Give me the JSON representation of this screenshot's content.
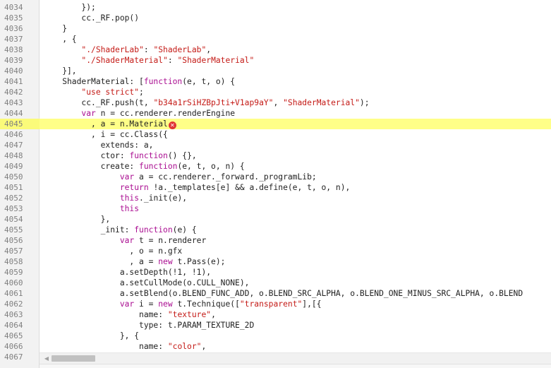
{
  "editor": {
    "highlight_line": "4045",
    "error_icon": "error-x-icon",
    "colors": {
      "keyword": "#aa0d91",
      "string": "#c41a16",
      "plain": "#222222",
      "line_number": "#808080",
      "highlight": "#ffff88",
      "error": "#e03535"
    },
    "lines": [
      {
        "n": "4034",
        "t": [
          [
            "        });",
            ""
          ]
        ]
      },
      {
        "n": "4035",
        "t": [
          [
            "        cc._RF.pop()",
            ""
          ]
        ]
      },
      {
        "n": "4036",
        "t": [
          [
            "    }",
            ""
          ]
        ]
      },
      {
        "n": "4037",
        "t": [
          [
            "    , {",
            ""
          ]
        ]
      },
      {
        "n": "4038",
        "t": [
          [
            "        ",
            ""
          ],
          [
            "\"./ShaderLab\"",
            "s"
          ],
          [
            ": ",
            ""
          ],
          [
            "\"ShaderLab\"",
            "s"
          ],
          [
            ",",
            ""
          ]
        ]
      },
      {
        "n": "4039",
        "t": [
          [
            "        ",
            ""
          ],
          [
            "\"./ShaderMaterial\"",
            "s"
          ],
          [
            ": ",
            ""
          ],
          [
            "\"ShaderMaterial\"",
            "s"
          ]
        ]
      },
      {
        "n": "4040",
        "t": [
          [
            "    }],",
            ""
          ]
        ]
      },
      {
        "n": "4041",
        "t": [
          [
            "    ShaderMaterial: [",
            ""
          ],
          [
            "function",
            "k"
          ],
          [
            "(e, t, o) {",
            ""
          ]
        ]
      },
      {
        "n": "4042",
        "t": [
          [
            "        ",
            ""
          ],
          [
            "\"use strict\"",
            "s"
          ],
          [
            ";",
            ""
          ]
        ]
      },
      {
        "n": "4043",
        "t": [
          [
            "        cc._RF.push(t, ",
            ""
          ],
          [
            "\"b34a1rSiHZBpJti+V1ap9aY\"",
            "s"
          ],
          [
            ", ",
            ""
          ],
          [
            "\"ShaderMaterial\"",
            "s"
          ],
          [
            ");",
            ""
          ]
        ]
      },
      {
        "n": "4044",
        "t": [
          [
            "        ",
            ""
          ],
          [
            "var",
            "k"
          ],
          [
            " n = cc.renderer.renderEngine",
            ""
          ]
        ]
      },
      {
        "n": "4045",
        "t": [
          [
            "          , a = n.Material",
            ""
          ]
        ],
        "err": true
      },
      {
        "n": "4046",
        "t": [
          [
            "          , i = cc.Class({",
            ""
          ]
        ]
      },
      {
        "n": "4047",
        "t": [
          [
            "            extends: a,",
            ""
          ]
        ]
      },
      {
        "n": "4048",
        "t": [
          [
            "            ctor: ",
            ""
          ],
          [
            "function",
            "k"
          ],
          [
            "() {},",
            ""
          ]
        ]
      },
      {
        "n": "4049",
        "t": [
          [
            "            create: ",
            ""
          ],
          [
            "function",
            "k"
          ],
          [
            "(e, t, o, n) {",
            ""
          ]
        ]
      },
      {
        "n": "4050",
        "t": [
          [
            "                ",
            ""
          ],
          [
            "var",
            "k"
          ],
          [
            " a = cc.renderer._forward._programLib;",
            ""
          ]
        ]
      },
      {
        "n": "4051",
        "t": [
          [
            "                ",
            ""
          ],
          [
            "return",
            "k"
          ],
          [
            " !a._templates[e] && a.define(e, t, o, n),",
            ""
          ]
        ]
      },
      {
        "n": "4052",
        "t": [
          [
            "                ",
            ""
          ],
          [
            "this",
            "k"
          ],
          [
            "._init(e),",
            ""
          ]
        ]
      },
      {
        "n": "4053",
        "t": [
          [
            "                ",
            ""
          ],
          [
            "this",
            "k"
          ]
        ]
      },
      {
        "n": "4054",
        "t": [
          [
            "            },",
            ""
          ]
        ]
      },
      {
        "n": "4055",
        "t": [
          [
            "            _init: ",
            ""
          ],
          [
            "function",
            "k"
          ],
          [
            "(e) {",
            ""
          ]
        ]
      },
      {
        "n": "4056",
        "t": [
          [
            "                ",
            ""
          ],
          [
            "var",
            "k"
          ],
          [
            " t = n.renderer",
            ""
          ]
        ]
      },
      {
        "n": "4057",
        "t": [
          [
            "                  , o = n.gfx",
            ""
          ]
        ]
      },
      {
        "n": "4058",
        "t": [
          [
            "                  , a = ",
            ""
          ],
          [
            "new",
            "k"
          ],
          [
            " t.Pass(e);",
            ""
          ]
        ]
      },
      {
        "n": "4059",
        "t": [
          [
            "                a.setDepth(!1, !1),",
            ""
          ]
        ]
      },
      {
        "n": "4060",
        "t": [
          [
            "                a.setCullMode(o.CULL_NONE),",
            ""
          ]
        ]
      },
      {
        "n": "4061",
        "t": [
          [
            "                a.setBlend(o.BLEND_FUNC_ADD, o.BLEND_SRC_ALPHA, o.BLEND_ONE_MINUS_SRC_ALPHA, o.BLEND",
            ""
          ]
        ]
      },
      {
        "n": "4062",
        "t": [
          [
            "                ",
            ""
          ],
          [
            "var",
            "k"
          ],
          [
            " i = ",
            ""
          ],
          [
            "new",
            "k"
          ],
          [
            " t.Technique([",
            ""
          ],
          [
            "\"transparent\"",
            "s"
          ],
          [
            "],[{",
            ""
          ]
        ]
      },
      {
        "n": "4063",
        "t": [
          [
            "                    name: ",
            ""
          ],
          [
            "\"texture\"",
            "s"
          ],
          [
            ",",
            ""
          ]
        ]
      },
      {
        "n": "4064",
        "t": [
          [
            "                    type: t.PARAM_TEXTURE_2D",
            ""
          ]
        ]
      },
      {
        "n": "4065",
        "t": [
          [
            "                }, {",
            ""
          ]
        ]
      },
      {
        "n": "4066",
        "t": [
          [
            "                    name: ",
            ""
          ],
          [
            "\"color\"",
            "s"
          ],
          [
            ",",
            ""
          ]
        ]
      },
      {
        "n": "4067",
        "t": [
          [
            "",
            ""
          ]
        ]
      }
    ]
  }
}
